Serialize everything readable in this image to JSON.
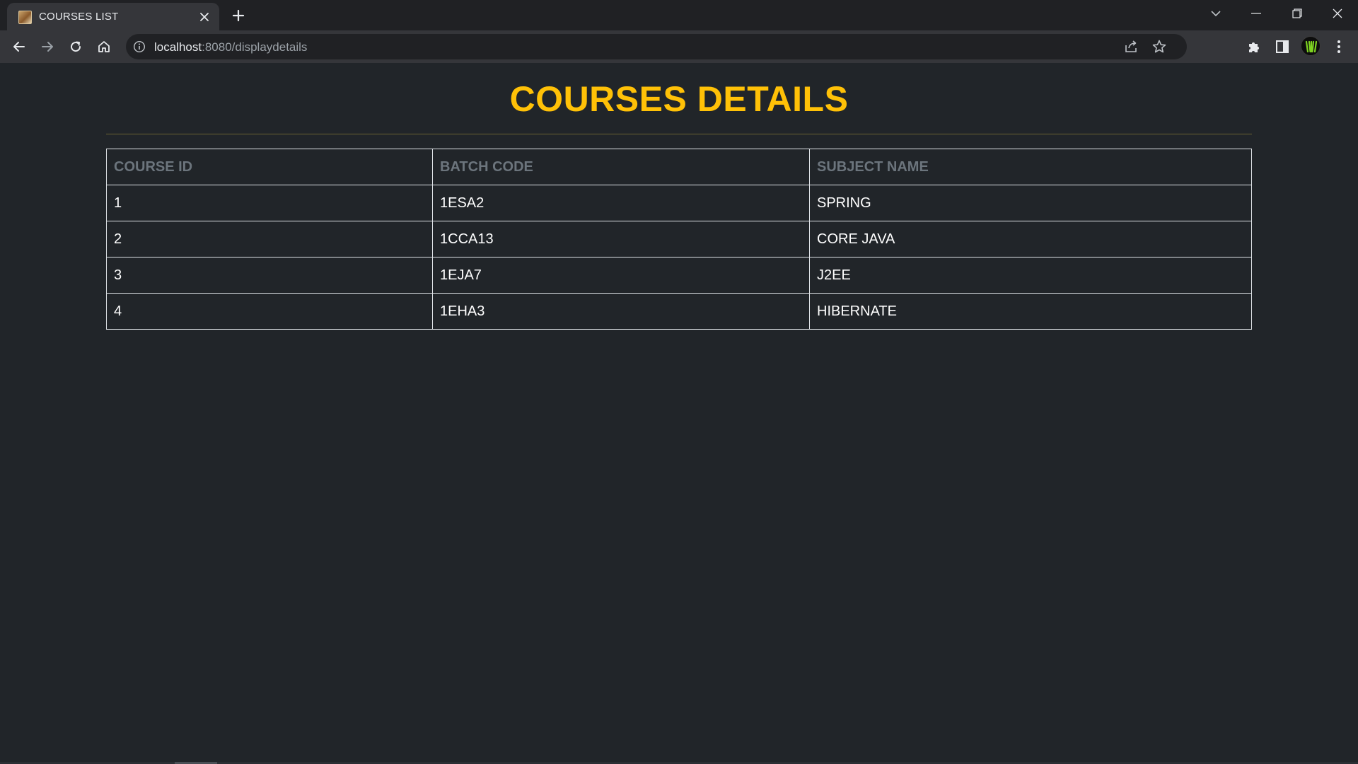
{
  "browser": {
    "tab_title": "COURSES LIST",
    "url_host": "localhost",
    "url_rest": ":8080/displaydetails"
  },
  "page": {
    "heading": "COURSES DETAILS",
    "accent_color": "#ffc107",
    "table": {
      "headers": [
        "COURSE ID",
        "BATCH CODE",
        "SUBJECT NAME"
      ],
      "rows": [
        [
          "1",
          "1ESA2",
          "SPRING"
        ],
        [
          "2",
          "1CCA13",
          "CORE JAVA"
        ],
        [
          "3",
          "1EJA7",
          "J2EE"
        ],
        [
          "4",
          "1EHA3",
          "HIBERNATE"
        ]
      ]
    }
  }
}
